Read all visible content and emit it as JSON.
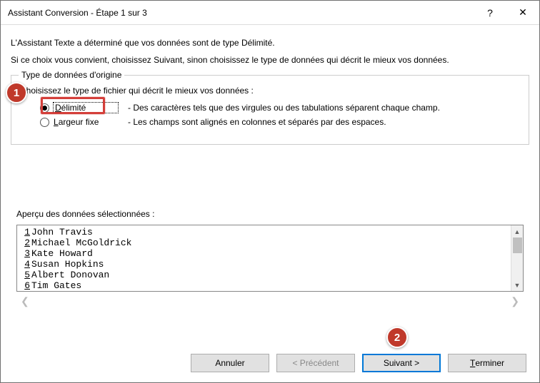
{
  "titlebar": {
    "title": "Assistant Conversion - Étape 1 sur 3",
    "help_label": "?",
    "close_label": "✕"
  },
  "intro": {
    "line1": "L'Assistant Texte a déterminé que vos données sont de type Délimité.",
    "line2": "Si ce choix vous convient, choisissez Suivant, sinon choisissez le type de données qui décrit le mieux vos données."
  },
  "fieldset": {
    "legend": "Type de données d'origine",
    "prompt": "Choisissez le type de fichier qui décrit le mieux vos données :",
    "options": [
      {
        "label_pre": "D",
        "label_rest": "élimité",
        "description": "- Des caractères tels que des virgules ou des tabulations séparent chaque champ.",
        "checked": true
      },
      {
        "label_pre": "L",
        "label_rest": "argeur fixe",
        "description": "- Les champs sont alignés en colonnes et séparés par des espaces.",
        "checked": false
      }
    ]
  },
  "preview": {
    "label": "Aperçu des données sélectionnées :",
    "rows": [
      {
        "n": "1",
        "text": "John Travis"
      },
      {
        "n": "2",
        "text": "Michael McGoldrick"
      },
      {
        "n": "3",
        "text": "Kate Howard"
      },
      {
        "n": "4",
        "text": "Susan Hopkins"
      },
      {
        "n": "5",
        "text": "Albert Donovan"
      },
      {
        "n": "6",
        "text": "Tim Gates"
      }
    ]
  },
  "buttons": {
    "cancel": "Annuler",
    "back": "< Précédent",
    "next": "Suivant >",
    "finish_pre": "T",
    "finish_rest": "erminer"
  },
  "callouts": {
    "one": "1",
    "two": "2"
  }
}
